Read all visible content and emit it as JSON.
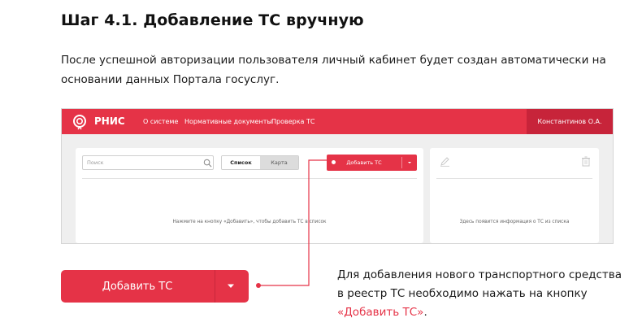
{
  "document": {
    "title": "Шаг 4.1. Добавление ТС вручную",
    "intro": "После успешной авторизации пользователя личный кабинет будет создан автоматически на основании данных Портала госуслуг.",
    "note_prefix": "Для добавления нового транспортного средства в реестр ТС необходимо нажать на кнопку ",
    "note_link": "«Добавить ТС»",
    "note_suffix": "."
  },
  "app": {
    "brand": "РНИС",
    "nav": [
      "О системе",
      "Нормативные документы",
      "Проверка ТС"
    ],
    "user": "Константинов О.А.",
    "search_placeholder": "Поиск",
    "tabs": {
      "list": "Список",
      "map": "Карта"
    },
    "add_button": "Добавить ТС",
    "left_empty": "Нажмите на кнопку «Добавить», чтобы добавить ТС в список",
    "right_empty": "Здесь появится информация о ТС из списка"
  },
  "callout": {
    "add_button": "Добавить ТС"
  },
  "colors": {
    "accent": "#e53347",
    "accent_dark": "#c7243a",
    "panel_bg": "#efefef"
  },
  "icons": [
    "logo-icon",
    "search-icon",
    "chevron-down-icon",
    "edit-icon",
    "trash-icon"
  ]
}
